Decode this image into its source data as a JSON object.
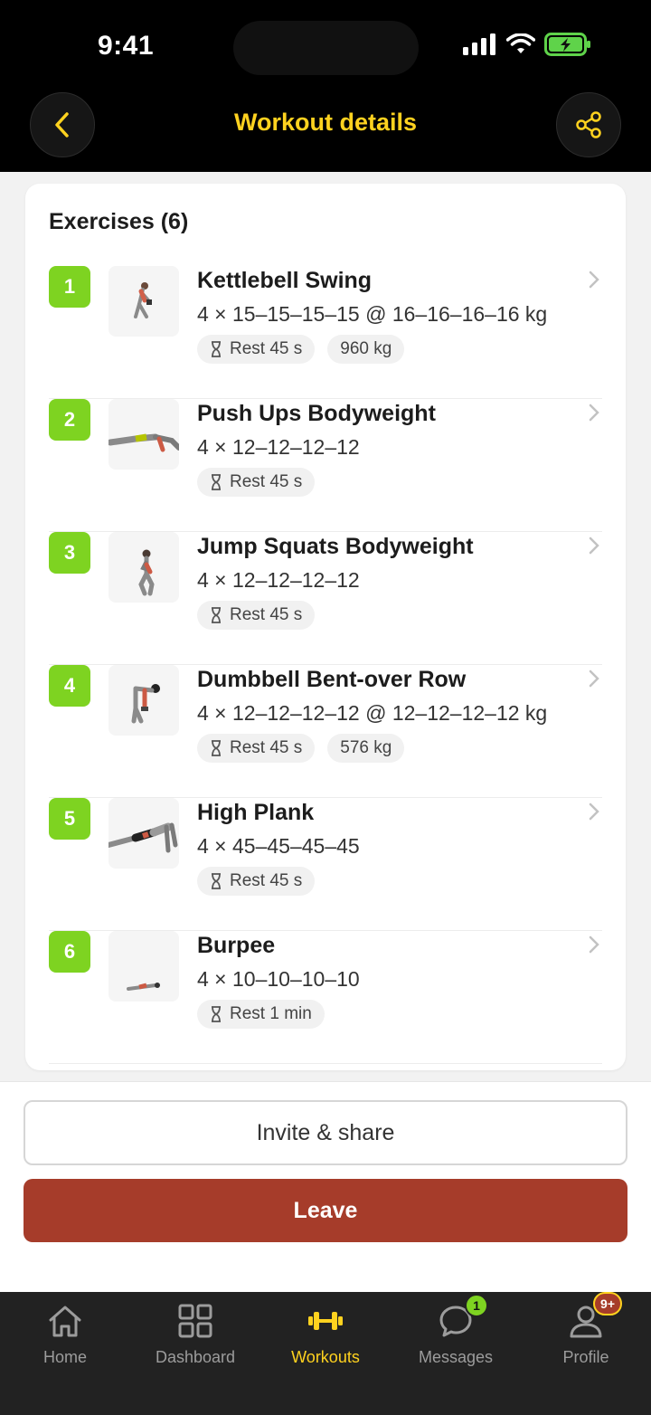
{
  "status_bar": {
    "time": "9:41"
  },
  "header": {
    "title": "Workout details"
  },
  "exercises_title": "Exercises (6)",
  "exercises": [
    {
      "num": "1",
      "name": "Kettlebell Swing",
      "sets": "4 × 15–15–15–15 @ 16–16–16–16 kg",
      "rest": "Rest 45 s",
      "volume": "960 kg"
    },
    {
      "num": "2",
      "name": "Push Ups Bodyweight",
      "sets": "4 × 12–12–12–12",
      "rest": "Rest 45 s",
      "volume": ""
    },
    {
      "num": "3",
      "name": "Jump Squats Bodyweight",
      "sets": "4 × 12–12–12–12",
      "rest": "Rest 45 s",
      "volume": ""
    },
    {
      "num": "4",
      "name": "Dumbbell Bent-over Row",
      "sets": "4 × 12–12–12–12 @ 12–12–12–12 kg",
      "rest": "Rest 45 s",
      "volume": "576 kg"
    },
    {
      "num": "5",
      "name": "High Plank",
      "sets": "4 × 45–45–45–45",
      "rest": "Rest 45 s",
      "volume": ""
    },
    {
      "num": "6",
      "name": "Burpee",
      "sets": "4 × 10–10–10–10",
      "rest": "Rest 1 min",
      "volume": ""
    }
  ],
  "actions": {
    "invite": "Invite & share",
    "leave": "Leave"
  },
  "tabs": [
    {
      "label": "Home",
      "icon": "home-icon"
    },
    {
      "label": "Dashboard",
      "icon": "dashboard-icon"
    },
    {
      "label": "Workouts",
      "icon": "dumbbell-icon"
    },
    {
      "label": "Messages",
      "icon": "chat-icon",
      "badge": "1"
    },
    {
      "label": "Profile",
      "icon": "profile-icon",
      "badge": "9+"
    }
  ],
  "colors": {
    "accent": "#ffd21f",
    "green": "#7ed321",
    "danger": "#a63c2a",
    "dark": "#000000"
  }
}
